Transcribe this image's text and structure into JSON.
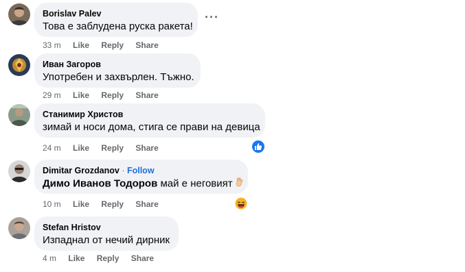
{
  "comments": [
    {
      "author": "Borislav Palev",
      "text": "Това е заблудена руска ракета!",
      "time": "33 m",
      "actions": [
        "Like",
        "Reply",
        "Share"
      ],
      "avatar_icon": "user-avatar-photo"
    },
    {
      "author": "Иван Загоров",
      "text": "Употребен и захвърлен. Тъжно.",
      "time": "29 m",
      "actions": [
        "Like",
        "Reply",
        "Share"
      ],
      "avatar_icon": "user-avatar-photo"
    },
    {
      "author": "Станимир Христов",
      "text": "зимай и носи дома, стига се прави на девица",
      "time": "24 m",
      "actions": [
        "Like",
        "Reply",
        "Share"
      ],
      "avatar_icon": "user-avatar-photo",
      "reaction": "like-icon"
    },
    {
      "author": "Dimitar Grozdanov",
      "follow": "Follow",
      "tag": "Димо Иванов Тодоров",
      "text": "май е неговият",
      "time": "10 m",
      "actions": [
        "Like",
        "Reply",
        "Share"
      ],
      "avatar_icon": "user-avatar-photo",
      "reaction": "haha-icon"
    },
    {
      "author": "Stefan Hristov",
      "text": "Изпаднал от нечий дирник",
      "time": "4 m",
      "actions": [
        "Like",
        "Reply",
        "Share"
      ],
      "avatar_icon": "user-avatar-photo"
    }
  ],
  "more_icon": "more-options-icon",
  "colors": {
    "bubble": "#f0f2f5",
    "meta": "#65676b",
    "link": "#216fdb",
    "like_blue": "#1877f2",
    "haha_yellow": "#f7b125"
  }
}
